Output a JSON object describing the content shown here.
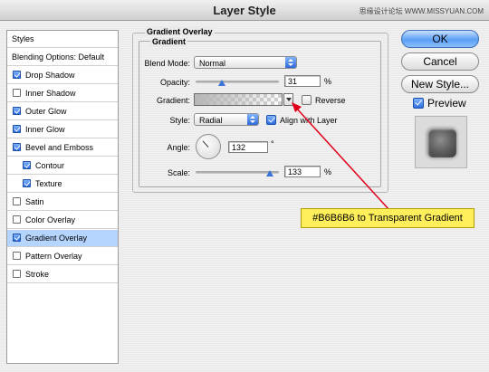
{
  "window": {
    "title": "Layer Style",
    "watermark": "思缘设计论坛 WWW.MISSYUAN.COM"
  },
  "sidebar": {
    "items": [
      {
        "label": "Styles",
        "has_checkbox": false,
        "checked": false,
        "selected": false,
        "indent": false
      },
      {
        "label": "Blending Options: Default",
        "has_checkbox": false,
        "checked": false,
        "selected": false,
        "indent": false
      },
      {
        "label": "Drop Shadow",
        "has_checkbox": true,
        "checked": true,
        "selected": false,
        "indent": false
      },
      {
        "label": "Inner Shadow",
        "has_checkbox": true,
        "checked": false,
        "selected": false,
        "indent": false
      },
      {
        "label": "Outer Glow",
        "has_checkbox": true,
        "checked": true,
        "selected": false,
        "indent": false
      },
      {
        "label": "Inner Glow",
        "has_checkbox": true,
        "checked": true,
        "selected": false,
        "indent": false
      },
      {
        "label": "Bevel and Emboss",
        "has_checkbox": true,
        "checked": true,
        "selected": false,
        "indent": false
      },
      {
        "label": "Contour",
        "has_checkbox": true,
        "checked": true,
        "selected": false,
        "indent": true
      },
      {
        "label": "Texture",
        "has_checkbox": true,
        "checked": true,
        "selected": false,
        "indent": true
      },
      {
        "label": "Satin",
        "has_checkbox": true,
        "checked": false,
        "selected": false,
        "indent": false
      },
      {
        "label": "Color Overlay",
        "has_checkbox": true,
        "checked": false,
        "selected": false,
        "indent": false
      },
      {
        "label": "Gradient Overlay",
        "has_checkbox": true,
        "checked": true,
        "selected": true,
        "indent": false
      },
      {
        "label": "Pattern Overlay",
        "has_checkbox": true,
        "checked": false,
        "selected": false,
        "indent": false
      },
      {
        "label": "Stroke",
        "has_checkbox": true,
        "checked": false,
        "selected": false,
        "indent": false
      }
    ]
  },
  "panel": {
    "outer_title": "Gradient Overlay",
    "inner_title": "Gradient",
    "blend_mode": {
      "label": "Blend Mode:",
      "value": "Normal"
    },
    "opacity": {
      "label": "Opacity:",
      "value": "31",
      "unit": "%",
      "level": 0.31
    },
    "gradient": {
      "label": "Gradient:",
      "start_color": "#B6B6B6",
      "end": "transparent"
    },
    "reverse": {
      "label": "Reverse",
      "checked": false
    },
    "style": {
      "label": "Style:",
      "value": "Radial"
    },
    "align_with_layer": {
      "label": "Align with Layer",
      "checked": true
    },
    "angle": {
      "label": "Angle:",
      "value": "132",
      "unit": "°"
    },
    "scale": {
      "label": "Scale:",
      "value": "133",
      "unit": "%",
      "level": 0.886
    }
  },
  "buttons": {
    "ok": "OK",
    "cancel": "Cancel",
    "new_style": "New Style..."
  },
  "preview": {
    "label": "Preview",
    "checked": true
  },
  "annotation": {
    "text": "#B6B6B6 to Transparent Gradient",
    "color": "#E0001B"
  },
  "colors": {
    "accent": "#3A74D8",
    "selection": "#B5D5FF",
    "callout_bg": "#FFEF5A"
  }
}
